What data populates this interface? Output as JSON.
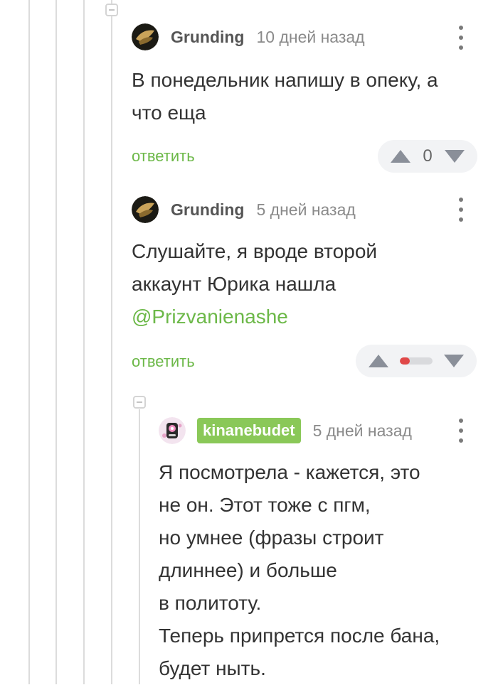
{
  "comments": [
    {
      "author": "Grunding",
      "time": "10 дней назад",
      "lines": [
        "В понедельник напишу в опеку, а",
        "что еща"
      ],
      "reply_label": "ответить",
      "rating": "0"
    },
    {
      "author": "Grunding",
      "time": "5 дней назад",
      "lines": [
        "Слушайте, я вроде второй",
        "аккаунт Юрика нашла"
      ],
      "mention": "@Prizvanienashe",
      "reply_label": "ответить",
      "rating_bar": {
        "negative_fraction": 0.3
      }
    },
    {
      "author": "kinanebudet",
      "time": "5 дней назад",
      "lines": [
        "Я посмотрела - кажется, это",
        "не он. Этот тоже с пгм,",
        "но умнее (фразы строит",
        "длиннее) и больше",
        "в политоту.",
        "Теперь припрется после бана,",
        "будет ныть."
      ]
    }
  ],
  "icons": {
    "collapse": "collapse-icon",
    "more": "more-vertical-icon",
    "upvote": "upvote-icon",
    "downvote": "downvote-icon"
  },
  "colors": {
    "accent_green": "#6cb848",
    "badge_green": "#8ac858",
    "negative_red": "#e04848",
    "thread_line": "#dcdcdc"
  }
}
